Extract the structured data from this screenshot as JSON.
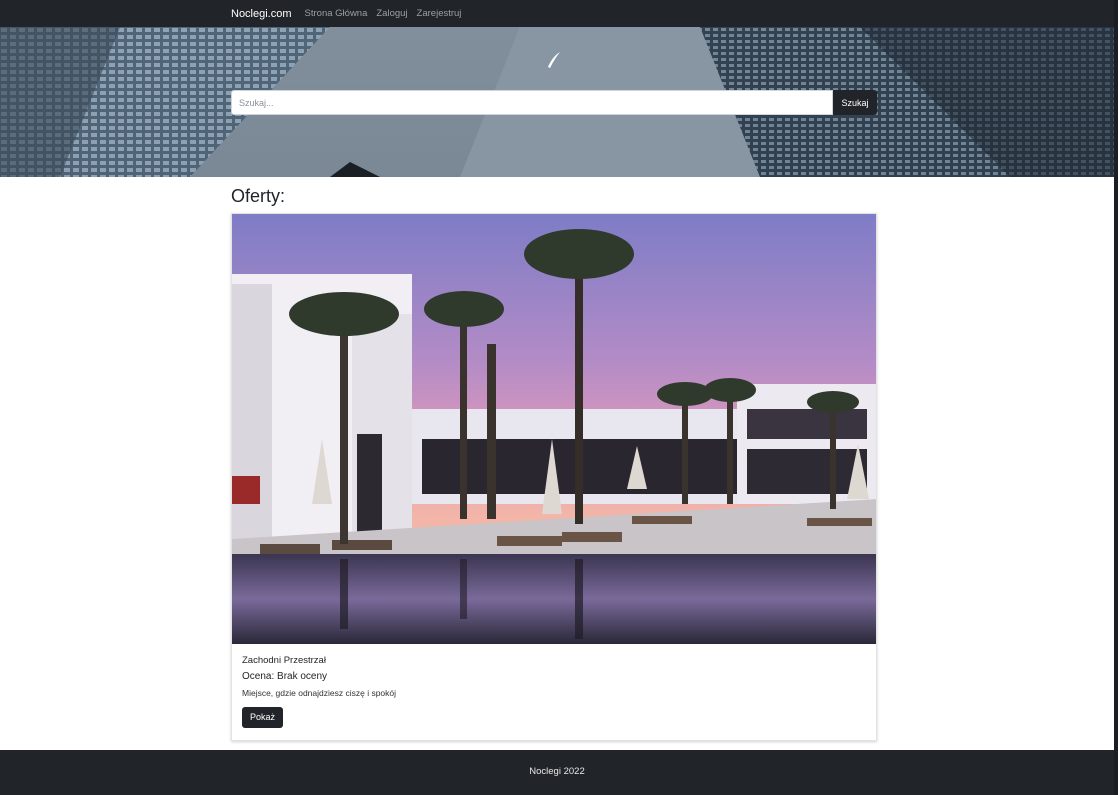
{
  "navbar": {
    "brand": "Noclegi.com",
    "links": [
      {
        "label": "Strona Główna"
      },
      {
        "label": "Zaloguj"
      },
      {
        "label": "Zarejestruj"
      }
    ]
  },
  "hero": {
    "logo_icon": "feather-icon",
    "search": {
      "placeholder": "Szukaj...",
      "value": "",
      "button_label": "Szukaj"
    }
  },
  "main": {
    "heading": "Oferty:",
    "offers": [
      {
        "image": "hotel-pool-at-sunset-photo",
        "title": "Zachodni Przestrzał",
        "rating": "Ocena: Brak oceny",
        "description": "Miejsce, gdzie odnajdziesz ciszę i spokój",
        "button_label": "Pokaż"
      }
    ]
  },
  "footer": {
    "text": "Noclegi 2022"
  },
  "colors": {
    "dark": "#212529",
    "nav_link": "#9aa0a6",
    "white": "#ffffff"
  }
}
